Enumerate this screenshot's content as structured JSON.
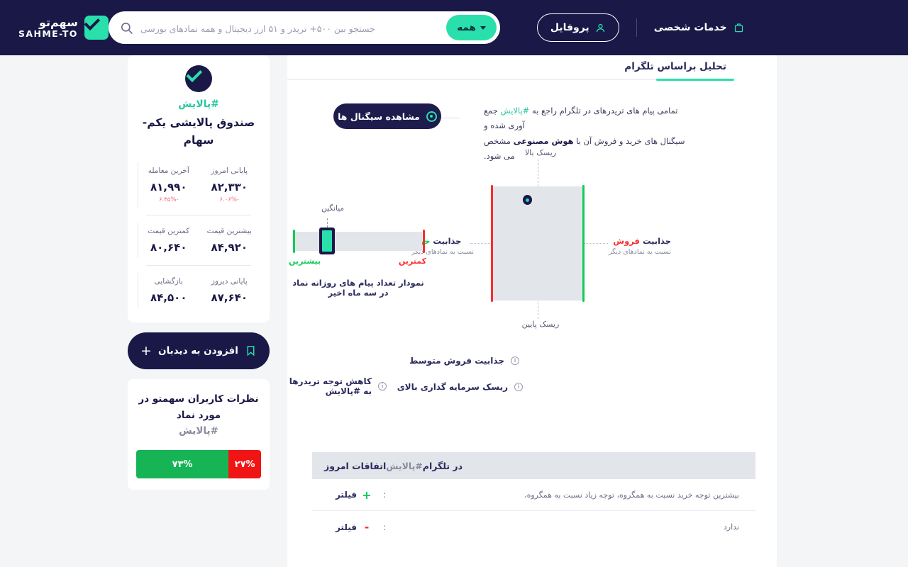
{
  "navbar": {
    "logo_fa": "سهم‌تو",
    "logo_en": "SAHME-TO",
    "logo_icon": "check-square-icon",
    "search": {
      "placeholder": "جستجو بین ۵۰۰+ تریدر و ۵۱ ارز دیجیتال و همه نمادهای بورسی",
      "filter_label": "همه",
      "search_icon": "search-icon",
      "chevron_icon": "chevron-down-icon"
    },
    "profile_label": "پروفایل",
    "profile_icon": "user-icon",
    "services_label": "خدمات شخصی",
    "services_icon": "briefcase-icon"
  },
  "tab": {
    "label": "تحلیل براساس تلگرام",
    "accent": "#29e0ac"
  },
  "intro": {
    "line1_a": "تمامی پیام های تریدرهای در تلگرام راجع به ",
    "line1_hash": "#پالایش",
    "line1_b": " جمع آوری شده و",
    "line2_a": "سیگنال های خرید و فروش آن با ",
    "line2_bold": "هوش مصنوعی",
    "line2_b": " مشخص می شود.",
    "signals_button": "مشاهده سیگنال ها",
    "signals_icon": "target-icon"
  },
  "quadrant": {
    "top_label": "ریسک بالا",
    "bottom_label": "ریسک پایین",
    "left_title_a": "جذابیت ",
    "left_title_b": "فروش",
    "left_sub": "نسبت به نمادهای دیگر",
    "right_title_a": "جذابیت ",
    "right_title_b": "خرید",
    "right_sub": "نسبت به نمادهای دیگر",
    "sell_color": "#fb2c2c",
    "buy_color": "#11cc55"
  },
  "slider": {
    "avg_label": "میانگین",
    "min_label": "کمترین",
    "max_label": "بیشترین",
    "caption": "نمودار تعداد پیام های روزانه نماد در سه ماه اخیر"
  },
  "badges": [
    {
      "label": "جذابیت فروش متوسط",
      "icon": "info-icon",
      "mark": "i"
    },
    {
      "label": "ریسک سرمایه گذاری بالای",
      "icon": "info-icon",
      "mark": "i"
    },
    {
      "label": "کاهش توجه تریدرها به #پالایش",
      "icon": "info-icon",
      "mark": "i"
    }
  ],
  "table": {
    "header_a": "اتفاقات امروز ",
    "header_hash": "#پالایش",
    "header_b": " در تلگرام",
    "rows": [
      {
        "filter": "فیلتر",
        "sign": "+",
        "colon": ":",
        "value": "بیشترین توجه خرید نسبت به همگروه،  توجه زیاد نسبت به همگروه،"
      },
      {
        "filter": "فیلتر",
        "sign": "-",
        "colon": ":",
        "value": "ندارد"
      }
    ]
  },
  "sidebar": {
    "avatar_icon": "check-circle-icon",
    "hashtag": "#پالایش",
    "fund_name": "صندوق پالایشی یکم-سهام",
    "stats": [
      {
        "label": "آخرین معامله",
        "value": "۸۱,۹۹۰",
        "change": "-۶.۴۵%"
      },
      {
        "label": "پایانی امروز",
        "value": "۸۲,۳۳۰",
        "change": "-۶.۰۶%"
      },
      {
        "label": "کمترین قیمت",
        "value": "۸۰,۶۴۰",
        "change": ""
      },
      {
        "label": "بیشترین قیمت",
        "value": "۸۴,۹۲۰",
        "change": ""
      },
      {
        "label": "بازگشایی",
        "value": "۸۴,۵۰۰",
        "change": ""
      },
      {
        "label": "پایانی دیروز",
        "value": "۸۷,۶۴۰",
        "change": ""
      }
    ],
    "watch_button": "افزودن به دیدبان",
    "watch_plus": "+",
    "watch_icon": "bookmark-icon",
    "opinion": {
      "title_a": "نظرات کاربران سهمتو در مورد نماد",
      "title_hash": "#پالایش",
      "positive": "۷۳%",
      "negative": "۲۷%",
      "positive_color": "#16b455",
      "negative_color": "#f01414"
    }
  }
}
